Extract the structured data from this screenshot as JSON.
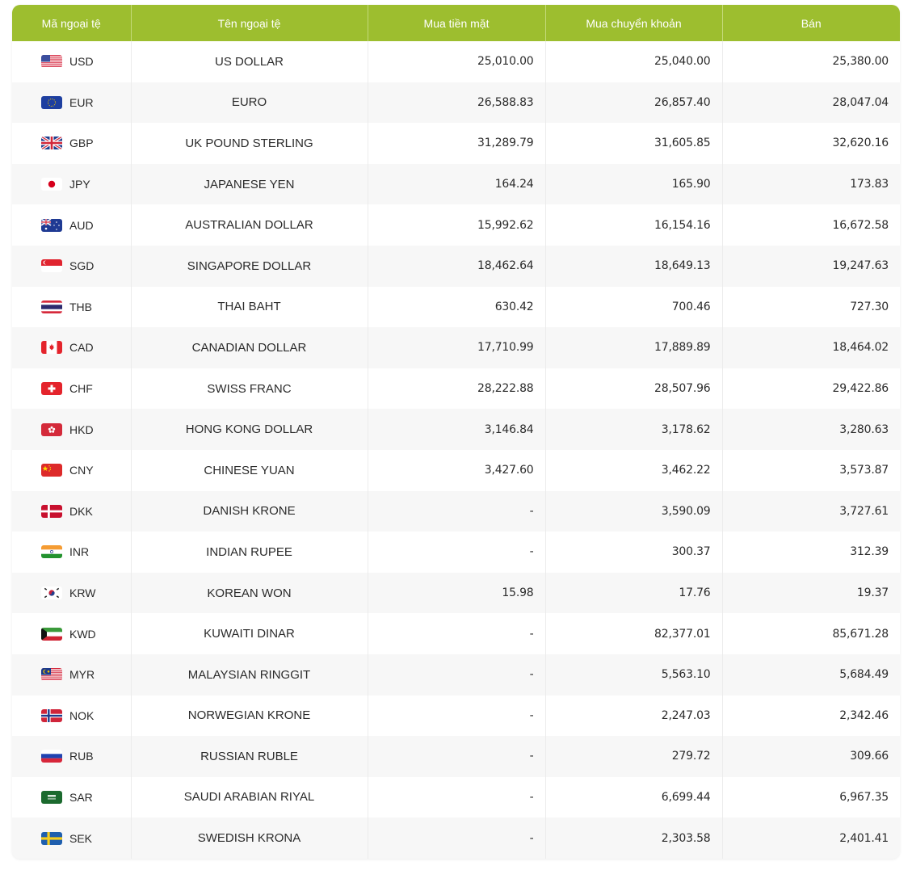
{
  "header": {
    "code": "Mã ngoại tệ",
    "name": "Tên ngoại tệ",
    "cash_buy": "Mua tiền mặt",
    "transfer_buy": "Mua chuyển khoản",
    "sell": "Bán"
  },
  "colors": {
    "header_bg": "#9dbe2f",
    "header_text": "#ffffff",
    "row_alt": "#f7f7f7"
  },
  "rows": [
    {
      "code": "USD",
      "flag": "us-flag-icon",
      "name": "US DOLLAR",
      "cash_buy": "25,010.00",
      "transfer_buy": "25,040.00",
      "sell": "25,380.00"
    },
    {
      "code": "EUR",
      "flag": "eu-flag-icon",
      "name": "EURO",
      "cash_buy": "26,588.83",
      "transfer_buy": "26,857.40",
      "sell": "28,047.04"
    },
    {
      "code": "GBP",
      "flag": "uk-flag-icon",
      "name": "UK POUND STERLING",
      "cash_buy": "31,289.79",
      "transfer_buy": "31,605.85",
      "sell": "32,620.16"
    },
    {
      "code": "JPY",
      "flag": "japan-flag-icon",
      "name": "JAPANESE YEN",
      "cash_buy": "164.24",
      "transfer_buy": "165.90",
      "sell": "173.83"
    },
    {
      "code": "AUD",
      "flag": "australia-flag-icon",
      "name": "AUSTRALIAN DOLLAR",
      "cash_buy": "15,992.62",
      "transfer_buy": "16,154.16",
      "sell": "16,672.58"
    },
    {
      "code": "SGD",
      "flag": "singapore-flag-icon",
      "name": "SINGAPORE DOLLAR",
      "cash_buy": "18,462.64",
      "transfer_buy": "18,649.13",
      "sell": "19,247.63"
    },
    {
      "code": "THB",
      "flag": "thailand-flag-icon",
      "name": "THAI BAHT",
      "cash_buy": "630.42",
      "transfer_buy": "700.46",
      "sell": "727.30"
    },
    {
      "code": "CAD",
      "flag": "canada-flag-icon",
      "name": "CANADIAN DOLLAR",
      "cash_buy": "17,710.99",
      "transfer_buy": "17,889.89",
      "sell": "18,464.02"
    },
    {
      "code": "CHF",
      "flag": "switzerland-flag-icon",
      "name": "SWISS FRANC",
      "cash_buy": "28,222.88",
      "transfer_buy": "28,507.96",
      "sell": "29,422.86"
    },
    {
      "code": "HKD",
      "flag": "hongkong-flag-icon",
      "name": "HONG KONG DOLLAR",
      "cash_buy": "3,146.84",
      "transfer_buy": "3,178.62",
      "sell": "3,280.63"
    },
    {
      "code": "CNY",
      "flag": "china-flag-icon",
      "name": "CHINESE YUAN",
      "cash_buy": "3,427.60",
      "transfer_buy": "3,462.22",
      "sell": "3,573.87"
    },
    {
      "code": "DKK",
      "flag": "denmark-flag-icon",
      "name": "DANISH KRONE",
      "cash_buy": "-",
      "transfer_buy": "3,590.09",
      "sell": "3,727.61"
    },
    {
      "code": "INR",
      "flag": "india-flag-icon",
      "name": "INDIAN RUPEE",
      "cash_buy": "-",
      "transfer_buy": "300.37",
      "sell": "312.39"
    },
    {
      "code": "KRW",
      "flag": "korea-flag-icon",
      "name": "KOREAN WON",
      "cash_buy": "15.98",
      "transfer_buy": "17.76",
      "sell": "19.37"
    },
    {
      "code": "KWD",
      "flag": "kuwait-flag-icon",
      "name": "KUWAITI DINAR",
      "cash_buy": "-",
      "transfer_buy": "82,377.01",
      "sell": "85,671.28"
    },
    {
      "code": "MYR",
      "flag": "malaysia-flag-icon",
      "name": "MALAYSIAN RINGGIT",
      "cash_buy": "-",
      "transfer_buy": "5,563.10",
      "sell": "5,684.49"
    },
    {
      "code": "NOK",
      "flag": "norway-flag-icon",
      "name": "NORWEGIAN KRONE",
      "cash_buy": "-",
      "transfer_buy": "2,247.03",
      "sell": "2,342.46"
    },
    {
      "code": "RUB",
      "flag": "russia-flag-icon",
      "name": "RUSSIAN RUBLE",
      "cash_buy": "-",
      "transfer_buy": "279.72",
      "sell": "309.66"
    },
    {
      "code": "SAR",
      "flag": "saudi-flag-icon",
      "name": "SAUDI ARABIAN RIYAL",
      "cash_buy": "-",
      "transfer_buy": "6,699.44",
      "sell": "6,967.35"
    },
    {
      "code": "SEK",
      "flag": "sweden-flag-icon",
      "name": "SWEDISH KRONA",
      "cash_buy": "-",
      "transfer_buy": "2,303.58",
      "sell": "2,401.41"
    }
  ]
}
